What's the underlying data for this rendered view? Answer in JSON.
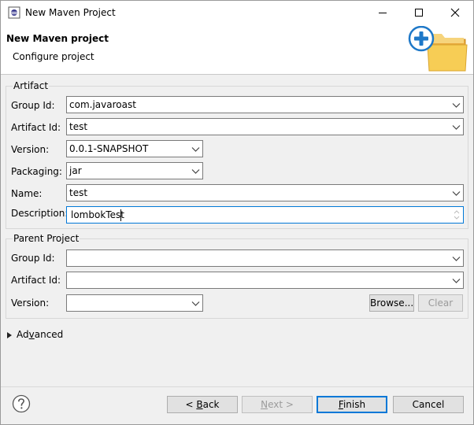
{
  "window": {
    "title": "New Maven Project"
  },
  "header": {
    "title": "New Maven project",
    "subtitle": "Configure project"
  },
  "artifact": {
    "legend": "Artifact",
    "group_id": {
      "label": "Group Id:",
      "value": "com.javaroast"
    },
    "artifact_id": {
      "label": "Artifact Id:",
      "value": "test"
    },
    "version": {
      "label": "Version:",
      "value": "0.0.1-SNAPSHOT"
    },
    "packaging": {
      "label": "Packaging:",
      "value": "jar"
    },
    "name": {
      "label": "Name:",
      "value": "test"
    },
    "description": {
      "label": "Description:",
      "value": "lombokTest"
    }
  },
  "parent": {
    "legend": "Parent Project",
    "group_id": {
      "label": "Group Id:",
      "value": ""
    },
    "artifact_id": {
      "label": "Artifact Id:",
      "value": ""
    },
    "version": {
      "label": "Version:",
      "value": ""
    },
    "browse_label": "Browse...",
    "clear_label": "Clear"
  },
  "advanced": {
    "prefix": "Ad",
    "mnemonic": "v",
    "suffix": "anced"
  },
  "footer": {
    "back": {
      "prefix": "< ",
      "mnemonic": "B",
      "suffix": "ack"
    },
    "next": {
      "mnemonic": "N",
      "suffix": "ext >"
    },
    "finish": {
      "mnemonic": "F",
      "suffix": "inish"
    },
    "cancel": "Cancel"
  },
  "icons": {
    "app": "eclipse-window-icon",
    "header_image": "new-folder-plus-icon",
    "help": "help-icon",
    "dropdown": "chevron-down-icon"
  },
  "colors": {
    "accent": "#0078d7",
    "folder": "#f5c542",
    "plus": "#1e78c8"
  }
}
